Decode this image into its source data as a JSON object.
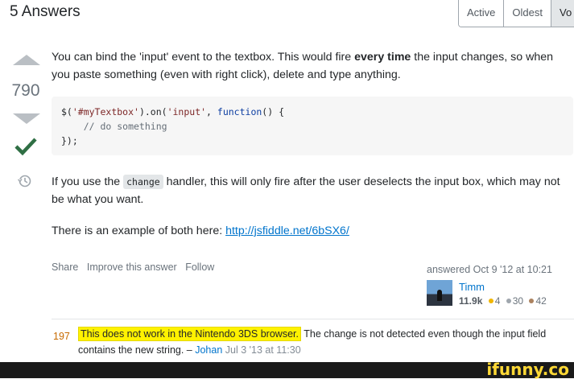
{
  "header": {
    "answers_count": "5 Answers"
  },
  "sort_tabs": [
    "Active",
    "Oldest",
    "Vo"
  ],
  "answer": {
    "votes": "790",
    "paragraph1": {
      "before": "You can bind the 'input' event to the textbox. This would fire ",
      "bold": "every time",
      "after": " the input changes, so when you paste something (even with right click), delete and type anything."
    },
    "code": {
      "line1_pre": "$(",
      "line1_str1": "'#myTextbox'",
      "line1_mid": ").on(",
      "line1_str2": "'input'",
      "line1_sep": ", ",
      "line1_kw": "function",
      "line1_end": "() {",
      "line2": "    // do something",
      "line3": "});"
    },
    "paragraph2": {
      "before": "If you use the ",
      "code": "change",
      "after": " handler, this will only fire after the user deselects the input box, which may not be what you want."
    },
    "paragraph3": {
      "before": "There is an example of both here: ",
      "link": "http://jsfiddle.net/6bSX6/"
    },
    "menu": {
      "share": "Share",
      "improve": "Improve this answer",
      "follow": "Follow"
    },
    "user": {
      "answered": "answered Oct 9 '12 at 10:21",
      "name": "Timm",
      "reputation": "11.9k",
      "gold": "4",
      "silver": "30",
      "bronze": "42"
    }
  },
  "comment": {
    "score": "197",
    "highlighted": "This does not work in the Nintendo 3DS browser.",
    "rest": " The change is not detected even though the input field contains the new string. – ",
    "author": "Johan",
    "date": " Jul 3 '13 at 11:30"
  },
  "watermark": "ifunny.co",
  "colors": {
    "accent": "#0074cc",
    "accepted": "#2f6f44",
    "highlight": "#fff200",
    "gold": "#f1b600",
    "silver": "#9fa6ad",
    "bronze": "#ab825f"
  }
}
